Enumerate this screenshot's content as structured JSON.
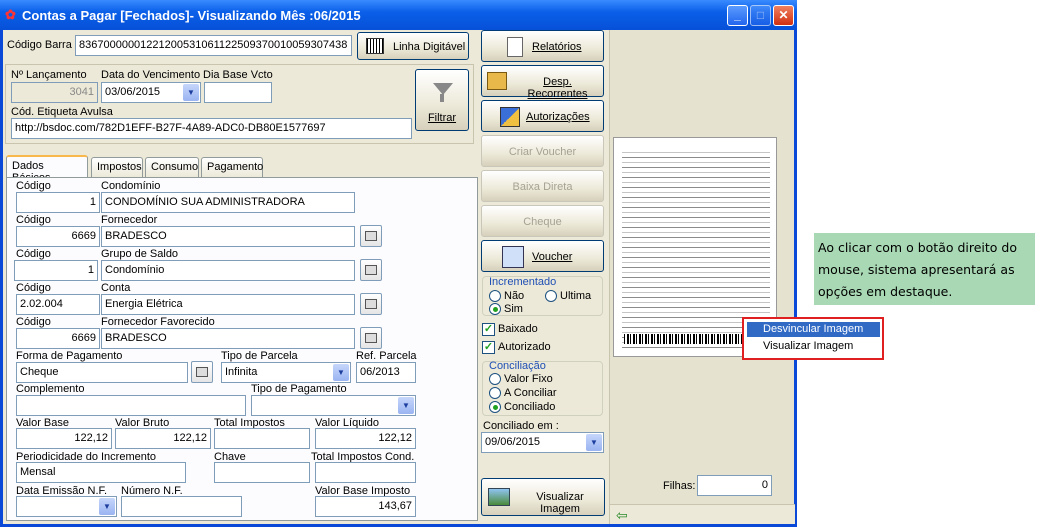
{
  "window": {
    "title": "Contas a Pagar [Fechados]- Visualizando Mês :06/2015"
  },
  "top": {
    "barcode_label": "Código Barra",
    "barcode_value": "83670000001221200531061122509370010059307438",
    "linha_digitavel": "Linha Digitável",
    "lanc_label": "Nº Lançamento",
    "lanc_value": "3041",
    "venc_label": "Data do Vencimento",
    "venc_value": "03/06/2015",
    "dia_base_label": "Dia Base Vcto",
    "dia_base_value": "",
    "etiqueta_label": "Cód. Etiqueta Avulsa",
    "etiqueta_value": "http://bsdoc.com/782D1EFF-B27F-4A89-ADC0-DB80E1577697",
    "filtrar": "Filtrar"
  },
  "tabs": [
    "Dados Básicos",
    "Impostos",
    "Consumo",
    "Pagamento"
  ],
  "form": {
    "codigo_label": "Código",
    "condominio_label": "Condomínio",
    "cond_code": "1",
    "cond_name": "CONDOMÍNIO SUA ADMINISTRADORA",
    "fornecedor_label": "Fornecedor",
    "forn_code": "6669",
    "forn_name": "BRADESCO",
    "grupo_label": "Grupo de Saldo",
    "grupo_code": "1",
    "grupo_name": "Condomínio",
    "conta_label": "Conta",
    "conta_code": "2.02.004",
    "conta_name": "Energia Elétrica",
    "favorecido_label": "Fornecedor Favorecido",
    "fav_code": "6669",
    "fav_name": "BRADESCO",
    "forma_label": "Forma de Pagamento",
    "forma_value": "Cheque",
    "tipo_parcela_label": "Tipo de Parcela",
    "tipo_parcela_value": "Infinita",
    "ref_parcela_label": "Ref. Parcela",
    "ref_parcela_value": "06/2013",
    "complemento_label": "Complemento",
    "complemento_value": "",
    "tipo_pag_label": "Tipo de Pagamento",
    "tipo_pag_value": "",
    "valor_base_label": "Valor Base",
    "valor_base": "122,12",
    "valor_bruto_label": "Valor Bruto",
    "valor_bruto": "122,12",
    "total_imp_label": "Total Impostos",
    "total_imp": "",
    "valor_liq_label": "Valor Líquido",
    "valor_liq": "122,12",
    "period_label": "Periodicidade do Incremento",
    "period_value": "Mensal",
    "chave_label": "Chave",
    "chave_value": "",
    "total_imp_cond_label": "Total Impostos Cond.",
    "total_imp_cond": "",
    "data_emissao_label": "Data Emissão N.F.",
    "data_emissao": "",
    "numero_nf_label": "Número N.F.",
    "numero_nf": "",
    "valor_base_imp_label": "Valor Base Imposto",
    "valor_base_imp": "143,67"
  },
  "actions": {
    "relatorios": "Relatórios",
    "desp_recorrentes": "Desp. Recorrentes",
    "autorizacoes": "Autorizações",
    "criar_voucher": "Criar Voucher",
    "baixa_direta": "Baixa Direta",
    "cheque": "Cheque",
    "voucher": "Voucher",
    "incrementado_label": "Incrementado",
    "nao": "Não",
    "ultima": "Ultima",
    "sim": "Sim",
    "baixado": "Baixado",
    "autorizado": "Autorizado",
    "conciliacao_label": "Conciliação",
    "valor_fixo": "Valor Fixo",
    "a_conciliar": "A Conciliar",
    "conciliado": "Conciliado",
    "conciliado_em_label": "Conciliado em :",
    "conciliado_em": "09/06/2015",
    "visualizar_imagem": "Visualizar Imagem"
  },
  "right": {
    "filhas_label": "Filhas:",
    "filhas_value": "0"
  },
  "context_menu": [
    "Desvincular Imagem",
    "Visualizar Imagem"
  ],
  "callout": "Ao clicar com o botão direito do mouse, sistema apresentará as opções em destaque.",
  "colors": {
    "title_bar": "#0a5fe8",
    "callout_bg": "#a9d9b4",
    "menu_highlight": "#316ac5",
    "highlight_border": "#e02020"
  }
}
